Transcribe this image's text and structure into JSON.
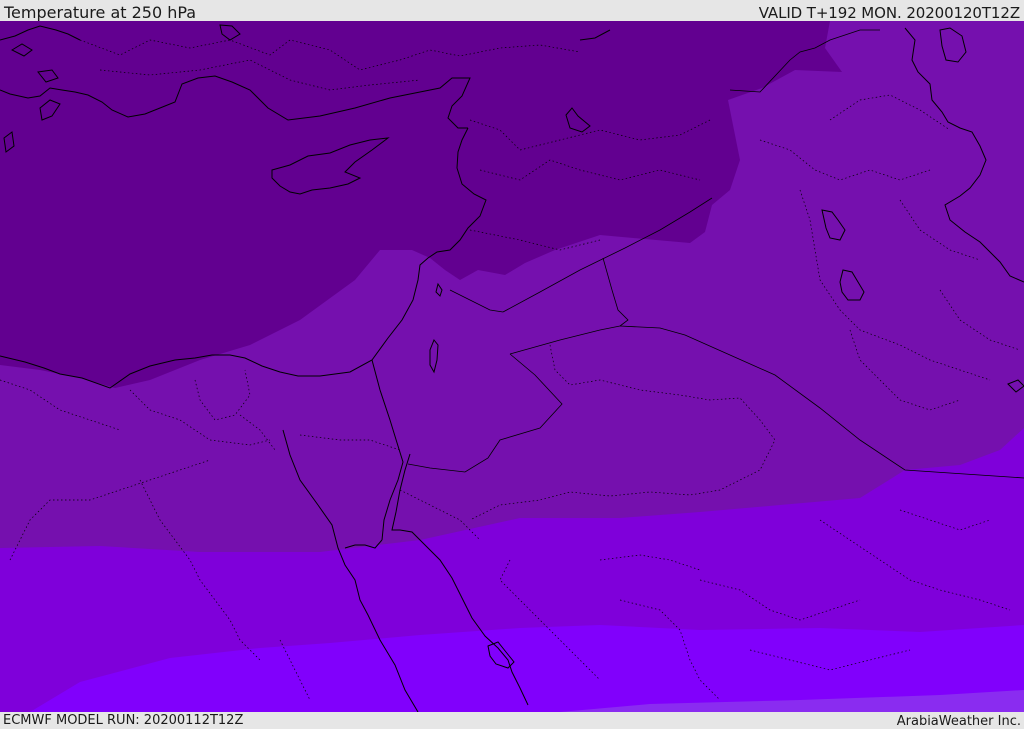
{
  "header": {
    "title": "Temperature at 250 hPa",
    "valid": "VALID T+192 MON. 20200120T12Z"
  },
  "footer": {
    "model_run": "ECMWF MODEL RUN: 20200112T12Z",
    "credit": "ArabiaWeather Inc."
  },
  "palette": {
    "band_1": "#620090",
    "band_2": "#7510ae",
    "band_3": "#7f00da",
    "band_4": "#8100fc",
    "band_5": "#8a2cf0"
  }
}
